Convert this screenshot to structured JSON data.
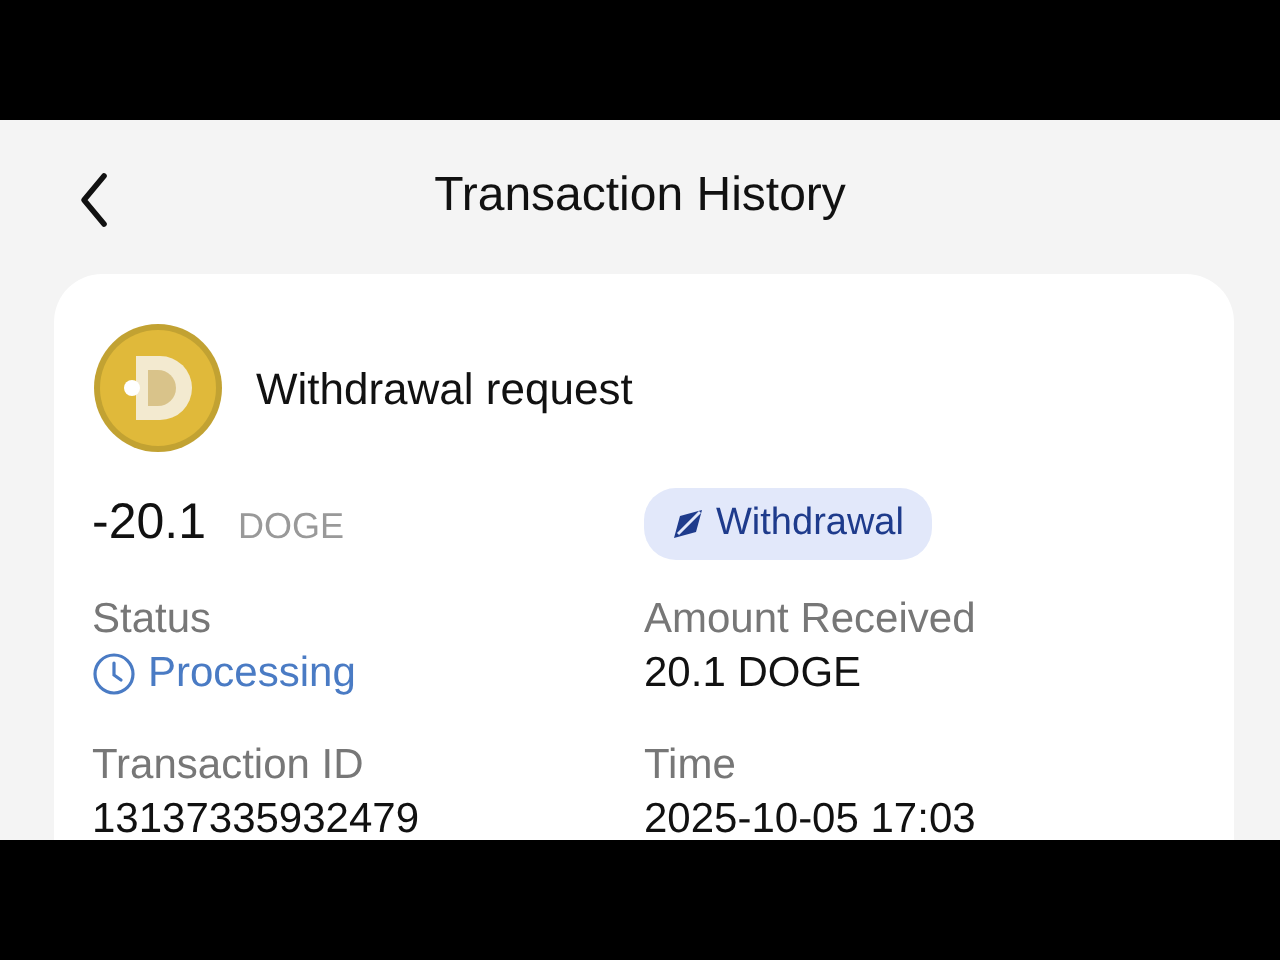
{
  "header": {
    "title": "Transaction History"
  },
  "card": {
    "title": "Withdrawal request",
    "amount": "-20.1",
    "currency": "DOGE",
    "badge": {
      "label": "Withdrawal",
      "kind": "withdrawal"
    },
    "fields": [
      {
        "label": "Status",
        "value": "Processing",
        "kind": "status"
      },
      {
        "label": "Amount Received",
        "value": "20.1 DOGE",
        "kind": "text"
      },
      {
        "label": "Transaction ID",
        "value": "13137335932479",
        "kind": "text"
      },
      {
        "label": "Time",
        "value": "2025-10-05 17:03",
        "kind": "text"
      }
    ]
  }
}
